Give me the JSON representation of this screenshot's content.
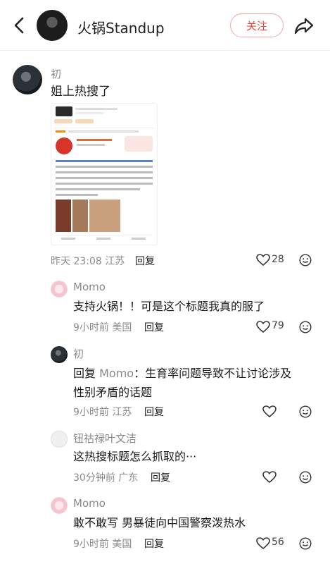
{
  "header": {
    "title": "火锅Standup",
    "follow_label": "关注"
  },
  "post": {
    "username": "初",
    "text": "姐上热搜了",
    "time": "昨天 23:08",
    "location": "江苏",
    "reply_label": "回复",
    "likes": "28"
  },
  "comments": [
    {
      "username": "Momo",
      "text": "支持火锅！！可是这个标题我真的服了",
      "time": "9小时前",
      "location": "美国",
      "reply_label": "回复",
      "likes": "79"
    },
    {
      "username": "初",
      "reply_prefix": "回复",
      "mention": "Momo",
      "text_line1": "：生育率问题导致不让讨论涉及",
      "text_line2": "性别矛盾的话题",
      "time": "9小时前",
      "location": "江苏",
      "reply_label": "回复",
      "likes": ""
    },
    {
      "username": "钮祜禄叶文洁",
      "text": "这热搜标题怎么抓取的···",
      "time": "30分钟前",
      "location": "广东",
      "reply_label": "回复",
      "likes": ""
    },
    {
      "username": "Momo",
      "text": "敢不敢写 男暴徒向中国警察泼热水",
      "time": "9小时前",
      "location": "美国",
      "reply_label": "回复",
      "likes": "56"
    }
  ],
  "icons": {
    "back": "chevron-left-icon",
    "share": "share-arrow-icon",
    "like": "heart-outline-icon",
    "emoji": "smiley-icon"
  },
  "colors": {
    "accent": "#e8483d",
    "muted": "#8a8a8a"
  }
}
